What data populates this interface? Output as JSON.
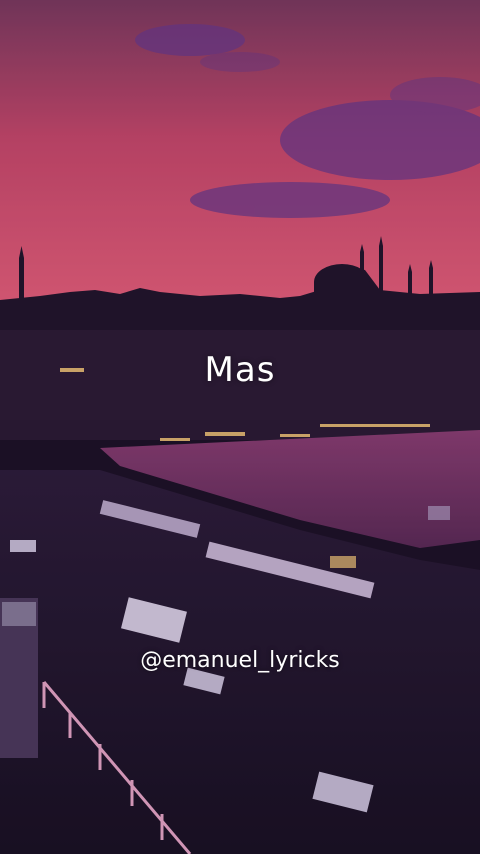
{
  "overlay": {
    "lyric_text": "Mas",
    "watermark_handle": "@emanuel_lyricks"
  },
  "colors": {
    "sky_top": "#7a3a5e",
    "sky_mid": "#c8486a",
    "sky_horizon": "#e8607a",
    "cloud": "#6b3a8a",
    "city_silhouette": "#1e1428",
    "water": "#7a3a6a",
    "lights": "#ffd27a"
  }
}
